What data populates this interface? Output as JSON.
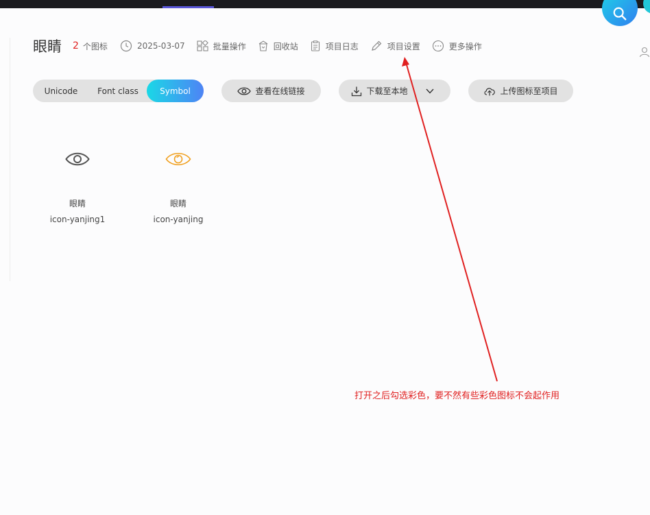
{
  "header": {
    "title": "眼睛",
    "icon_count": "2",
    "icon_count_unit": "个图标",
    "date": "2025-03-07",
    "actions": [
      {
        "label": "批量操作",
        "icon": "batch-icon"
      },
      {
        "label": "回收站",
        "icon": "recycle-bin-icon"
      },
      {
        "label": "项目日志",
        "icon": "log-icon"
      },
      {
        "label": "项目设置",
        "icon": "pencil-icon"
      },
      {
        "label": "更多操作",
        "icon": "more-icon"
      }
    ]
  },
  "format_tabs": [
    "Unicode",
    "Font class",
    "Symbol"
  ],
  "active_format": "Symbol",
  "toolbar": {
    "view_link": "查看在线链接",
    "download": "下载至本地",
    "upload": "上传图标至项目"
  },
  "icons": [
    {
      "name": "眼睛",
      "code": "icon-yanjing1",
      "color": "#555555"
    },
    {
      "name": "眼睛",
      "code": "icon-yanjing",
      "color": "#f0a020"
    }
  ],
  "annotation": "打开之后勾选彩色，要不然有些彩色图标不会起作用",
  "colors": {
    "accent_gradient_start": "#1ad8e6",
    "accent_gradient_end": "#4e83f5",
    "annotation_red": "#e02020"
  }
}
